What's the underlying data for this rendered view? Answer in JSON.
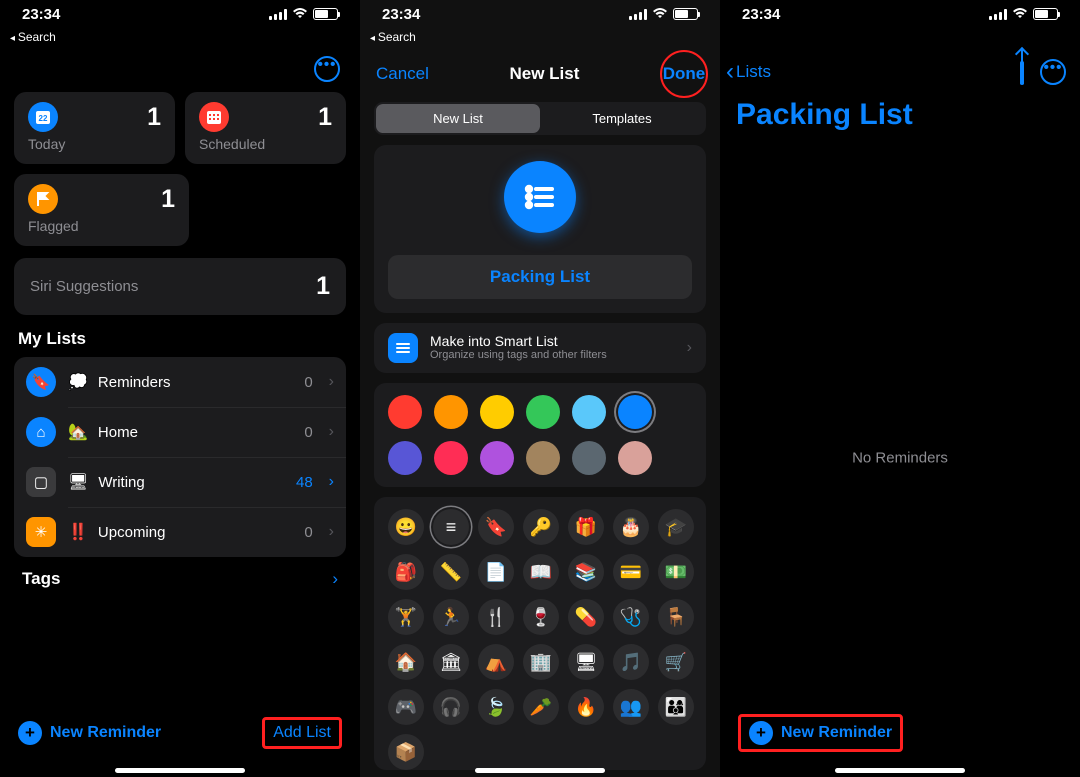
{
  "status": {
    "time": "23:34"
  },
  "panel1": {
    "back": "Search",
    "tiles": {
      "today": {
        "label": "Today",
        "count": "1",
        "color": "#0a84ff",
        "glyph": "22"
      },
      "scheduled": {
        "label": "Scheduled",
        "count": "1",
        "color": "#ff3b30"
      },
      "flagged": {
        "label": "Flagged",
        "count": "1",
        "color": "#ff9500"
      }
    },
    "siri": {
      "label": "Siri Suggestions",
      "count": "1"
    },
    "mylists_header": "My Lists",
    "lists": [
      {
        "emoji": "💭",
        "name": "Reminders",
        "count": "0",
        "iconbg": "#0a84ff",
        "icon": "bookmark"
      },
      {
        "emoji": "🏡",
        "name": "Home",
        "count": "0",
        "iconbg": "#0a84ff",
        "icon": "home"
      },
      {
        "emoji": "🖥",
        "name": "Writing",
        "count": "48",
        "accent": true,
        "iconbg": "#3a3a3c",
        "icon": "tv"
      },
      {
        "emoji": "‼️",
        "name": "Upcoming",
        "count": "0",
        "iconbg": "#ff9500",
        "icon": "star"
      }
    ],
    "tags_header": "Tags",
    "new_reminder": "New Reminder",
    "add_list": "Add List"
  },
  "panel2": {
    "back": "Search",
    "cancel": "Cancel",
    "title": "New List",
    "done": "Done",
    "seg_new": "New List",
    "seg_templates": "Templates",
    "list_name": "Packing List",
    "smart_title": "Make into Smart List",
    "smart_sub": "Organize using tags and other filters",
    "colors": [
      "#ff3b30",
      "#ff9500",
      "#ffcc00",
      "#34c759",
      "#5ac8fa",
      "#0a84ff",
      "#5856d6",
      "#ff2d55",
      "#af52de",
      "#a2845e",
      "#5b6770",
      "#d9a19a"
    ],
    "color_selected_index": 5,
    "icon_selected_index": 1,
    "icons": [
      "😀",
      "≡",
      "🔖",
      "🔑",
      "🎁",
      "🎂",
      "🎓",
      "🎒",
      "📏",
      "📄",
      "📖",
      "📚",
      "💳",
      "💵",
      "🏋",
      "🏃",
      "🍴",
      "🍷",
      "💊",
      "🩺",
      "🪑",
      "🏠",
      "🏛",
      "⛺",
      "🏢",
      "🖥",
      "🎵",
      "🛒",
      "🎮",
      "🎧",
      "🍃",
      "🥕",
      "🔥",
      "👥",
      "👨‍👩‍👦",
      "📦"
    ]
  },
  "panel3": {
    "back": "Lists",
    "title": "Packing List",
    "empty": "No Reminders",
    "new_reminder": "New Reminder"
  }
}
